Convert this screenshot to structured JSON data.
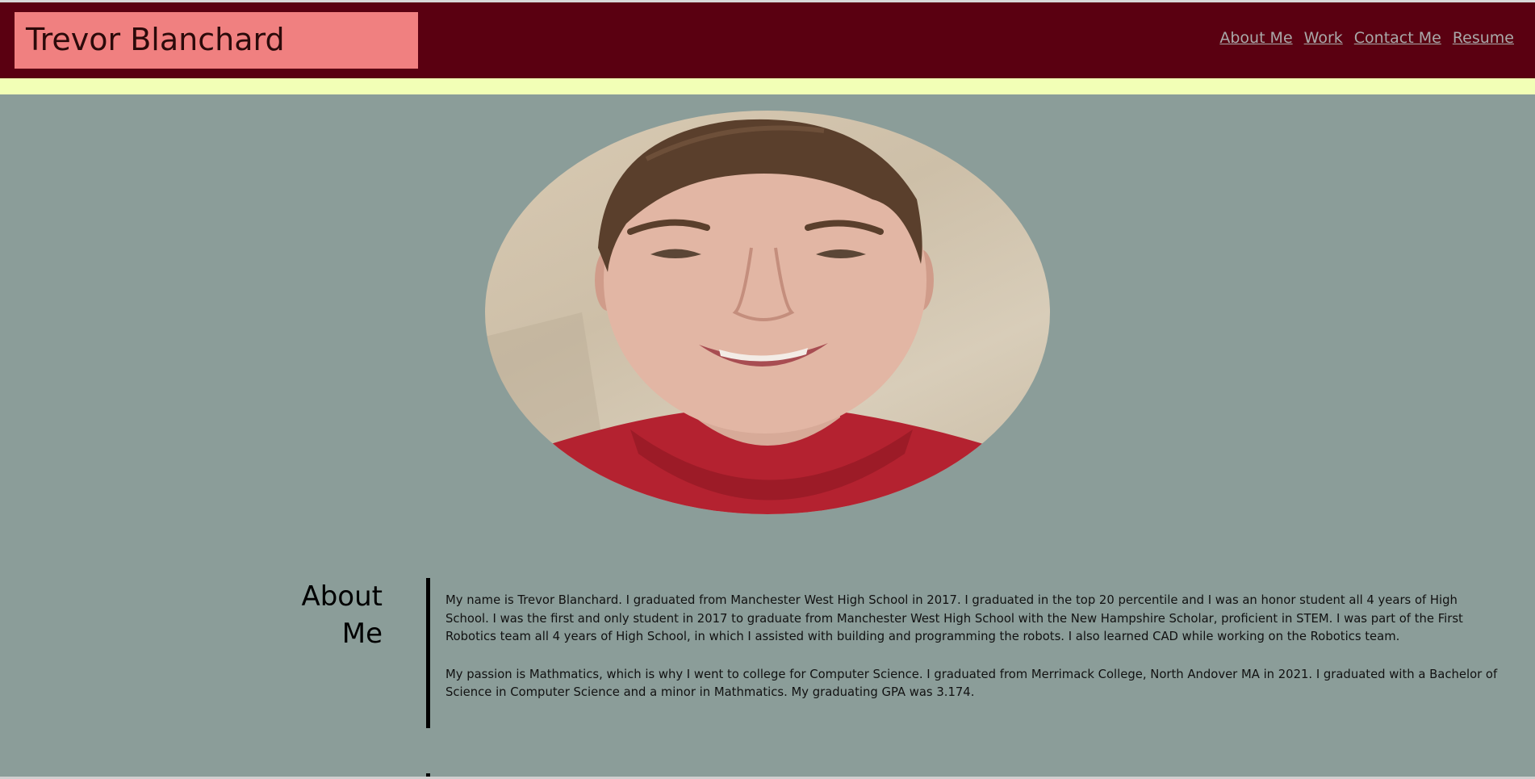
{
  "header": {
    "title": "Trevor Blanchard",
    "nav": [
      "About Me",
      "Work",
      "Contact Me",
      "Resume"
    ]
  },
  "profile": {
    "image_alt": "portrait-photo"
  },
  "about": {
    "heading_line1": "About",
    "heading_line2": "Me",
    "paragraphs": [
      "My name is Trevor Blanchard. I graduated from Manchester West High School in 2017. I graduated in the top 20 percentile and I was an honor student all 4 years of High School. I was the first and only student in 2017 to graduate from Manchester West High School with the New Hampshire Scholar, proficient in STEM. I was part of the First Robotics team all 4 years of High School, in which I assisted with building and programming the robots. I also learned CAD while working on the Robotics team.",
      "My passion is Mathmatics, which is why I went to college for Computer Science. I graduated from Merrimack College, North Andover MA in 2021. I graduated with a Bachelor of Science in Computer Science and a minor in Mathmatics. My graduating GPA was 3.174."
    ]
  },
  "colors": {
    "header_bg": "#5a0011",
    "title_box": "#f08080",
    "accent_bar": "#f2ffb6",
    "page_bg": "#8b9d99",
    "nav_link": "#a9a9a9"
  }
}
